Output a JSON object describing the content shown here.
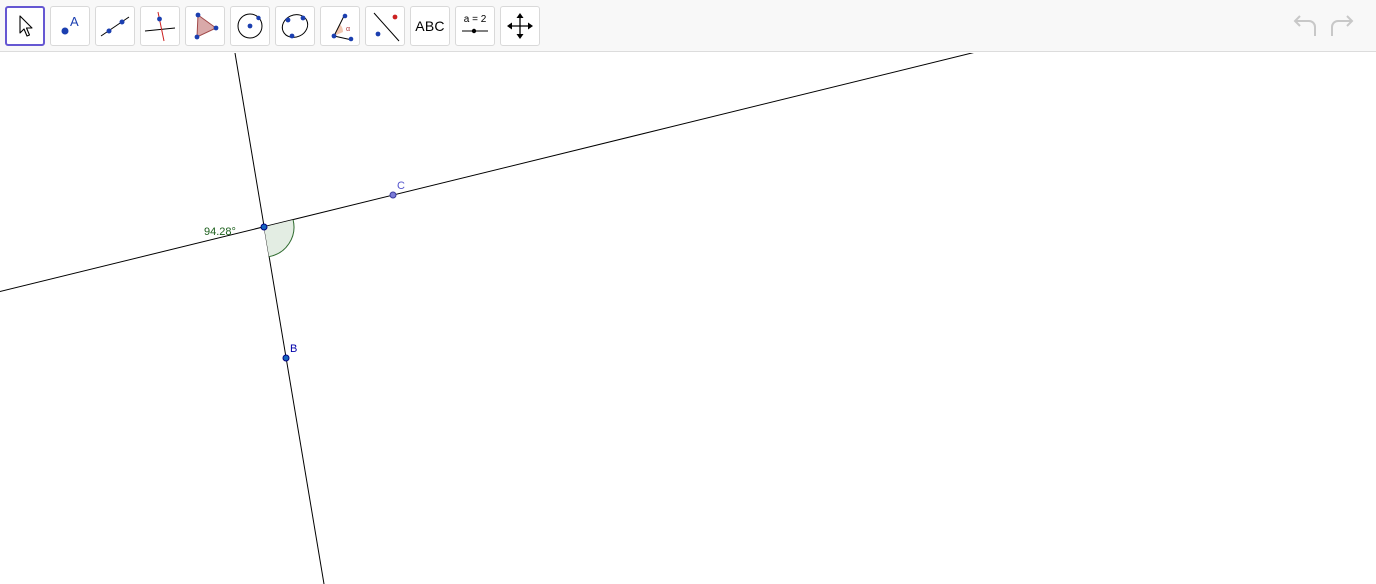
{
  "toolbar": {
    "tools": [
      {
        "name": "move-tool",
        "icon": "arrow-pointer-icon"
      },
      {
        "name": "point-tool",
        "icon": "point-icon",
        "text": "A"
      },
      {
        "name": "line-tool",
        "icon": "line-through-points-icon"
      },
      {
        "name": "perpendicular-line-tool",
        "icon": "perpendicular-line-icon"
      },
      {
        "name": "polygon-tool",
        "icon": "polygon-icon"
      },
      {
        "name": "circle-tool",
        "icon": "circle-center-point-icon"
      },
      {
        "name": "circle-three-points-tool",
        "icon": "circle-three-points-icon"
      },
      {
        "name": "angle-tool",
        "icon": "angle-icon"
      },
      {
        "name": "reflect-tool",
        "icon": "reflect-about-line-icon"
      },
      {
        "name": "text-tool",
        "icon": "text-icon",
        "text": "ABC"
      },
      {
        "name": "slider-tool",
        "icon": "slider-icon",
        "text": "a = 2"
      },
      {
        "name": "move-graphics-view-tool",
        "icon": "move-arrows-icon"
      }
    ],
    "selected_tool": "move-tool",
    "undo_icon": "undo-icon",
    "redo_icon": "redo-icon"
  },
  "graphics": {
    "angle_label": "94.28°",
    "point_b_label": "B",
    "point_c_label": "C",
    "colors": {
      "line": "#000000",
      "point_fill": "#1565c0",
      "point_stroke": "#00007f",
      "point_c_fill": "#7b7bd6",
      "point_label": "#0000aa",
      "point_c_label": "#5555cc",
      "angle_fill": "#e3ede3",
      "angle_stroke": "#2e6b2e",
      "angle_label": "#1a5e1a",
      "selected_border": "#6557d2"
    }
  }
}
